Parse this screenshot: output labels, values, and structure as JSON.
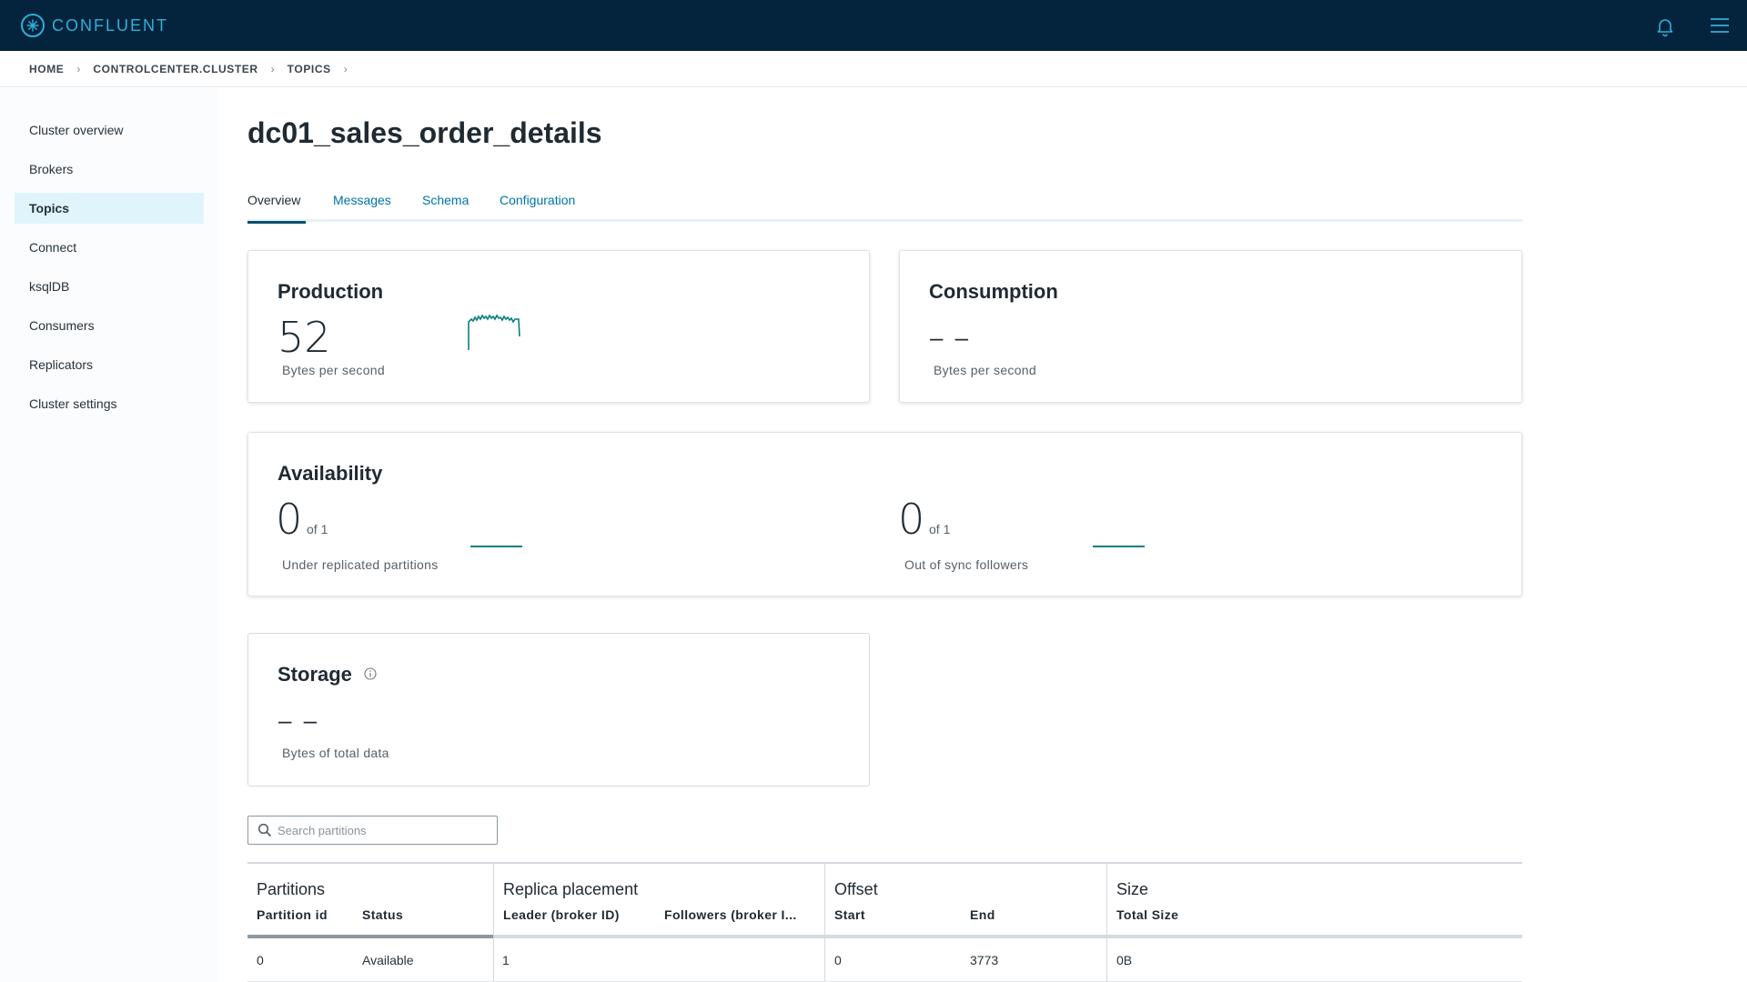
{
  "brand": {
    "name": "CONFLUENT",
    "accent": "#2fb0d7",
    "topbar_bg": "#04233d"
  },
  "breadcrumb": [
    "HOME",
    "CONTROLCENTER.CLUSTER",
    "TOPICS"
  ],
  "sidebar": {
    "items": [
      {
        "label": "Cluster overview"
      },
      {
        "label": "Brokers"
      },
      {
        "label": "Topics",
        "active": true
      },
      {
        "label": "Connect"
      },
      {
        "label": "ksqlDB"
      },
      {
        "label": "Consumers"
      },
      {
        "label": "Replicators"
      },
      {
        "label": "Cluster settings"
      }
    ]
  },
  "page": {
    "title": "dc01_sales_order_details"
  },
  "tabs": [
    {
      "label": "Overview",
      "active": true
    },
    {
      "label": "Messages"
    },
    {
      "label": "Schema"
    },
    {
      "label": "Configuration"
    }
  ],
  "production": {
    "title": "Production",
    "value": "52",
    "unit": "Bytes per second"
  },
  "consumption": {
    "title": "Consumption",
    "value": "– –",
    "unit": "Bytes per second"
  },
  "availability": {
    "title": "Availability",
    "under_replicated": {
      "value": "0",
      "of": "of 1",
      "label": "Under replicated partitions"
    },
    "out_of_sync": {
      "value": "0",
      "of": "of 1",
      "label": "Out of sync followers"
    }
  },
  "storage": {
    "title": "Storage",
    "value": "– –",
    "unit": "Bytes of total data"
  },
  "search": {
    "placeholder": "Search partitions"
  },
  "table": {
    "groups": {
      "partitions": "Partitions",
      "replica": "Replica placement",
      "offset": "Offset",
      "size": "Size"
    },
    "columns": {
      "partition_id": "Partition id",
      "status": "Status",
      "leader": "Leader (broker ID)",
      "followers": "Followers (broker I...",
      "start": "Start",
      "end": "End",
      "total_size": "Total Size"
    },
    "rows": [
      {
        "partition_id": "0",
        "status": "Available",
        "leader": "1",
        "followers": "",
        "start": "0",
        "end": "3773",
        "total_size": "0B"
      }
    ]
  }
}
